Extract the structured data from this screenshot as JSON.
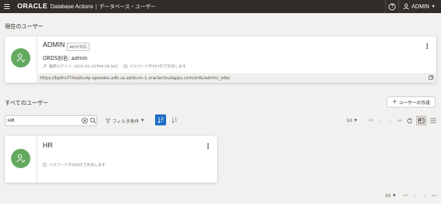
{
  "topbar": {
    "logo": "ORACLE",
    "product": "Database Actions",
    "separator": "|",
    "page_name": "データベース・ユーザー",
    "help_label": "?",
    "user": "ADMIN"
  },
  "current_section": {
    "title": "現在のユーザー",
    "card": {
      "name": "ADMIN",
      "badge": "REST対応",
      "alias": "ORDS別名: admin",
      "last_login": "最終ログイン: 2021-01-20T04:26:56Z",
      "password_expiry": "パスワードが357日で失効します",
      "url": "https://bp9ncf74sqibu4p-apexdev.adb.us-ashburn-1.oraclecloudapps.com/ords/admin/_sdw/"
    }
  },
  "all_section": {
    "title": "すべてのユーザー",
    "create_button": "ユーザーの作成",
    "search_value": "HR",
    "filter_label": "フィルタ条件",
    "page_size": "50",
    "users": [
      {
        "name": "HR",
        "password_expiry": "パスワードが359日で失効します"
      }
    ]
  },
  "colors": {
    "topbar": "#312d2a",
    "avatar": "#63a95f",
    "accent": "#1f6fc5",
    "background": "#f2f1ef"
  }
}
